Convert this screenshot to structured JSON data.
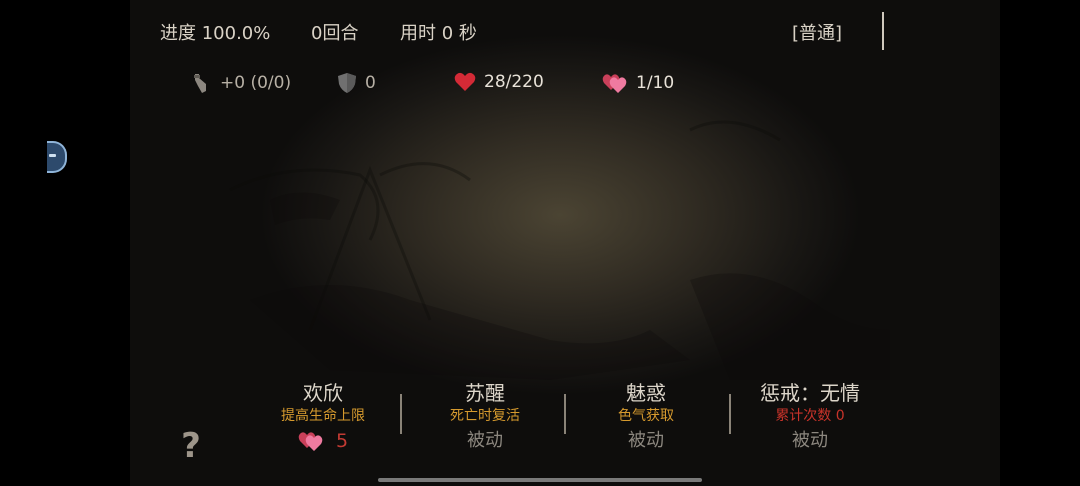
{
  "top_bar": {
    "progress": "进度 100.0%",
    "rounds": "0回合",
    "time": "用时 0 秒",
    "difficulty": "[普通]"
  },
  "stats": {
    "attack": "+0 (0/0)",
    "defense": "0",
    "hp": "28/220",
    "charm": "1/10"
  },
  "skills": [
    {
      "name": "欢欣",
      "desc": "提高生命上限",
      "count": "5"
    },
    {
      "name": "苏醒",
      "desc": "死亡时复活",
      "type": "被动"
    },
    {
      "name": "魅惑",
      "desc": "色气获取",
      "type": "被动"
    },
    {
      "name": "惩戒：无情",
      "desc": "累计次数 0",
      "type": "被动"
    }
  ],
  "help_label": "?",
  "colors": {
    "accent_orange": "#d69a2e",
    "accent_red": "#c8332a",
    "heart_red": "#d42a36",
    "heart_pink": "#e85a88"
  },
  "icons": [
    "sword-icon",
    "shield-icon",
    "heart-icon",
    "double-heart-icon",
    "question-icon"
  ]
}
